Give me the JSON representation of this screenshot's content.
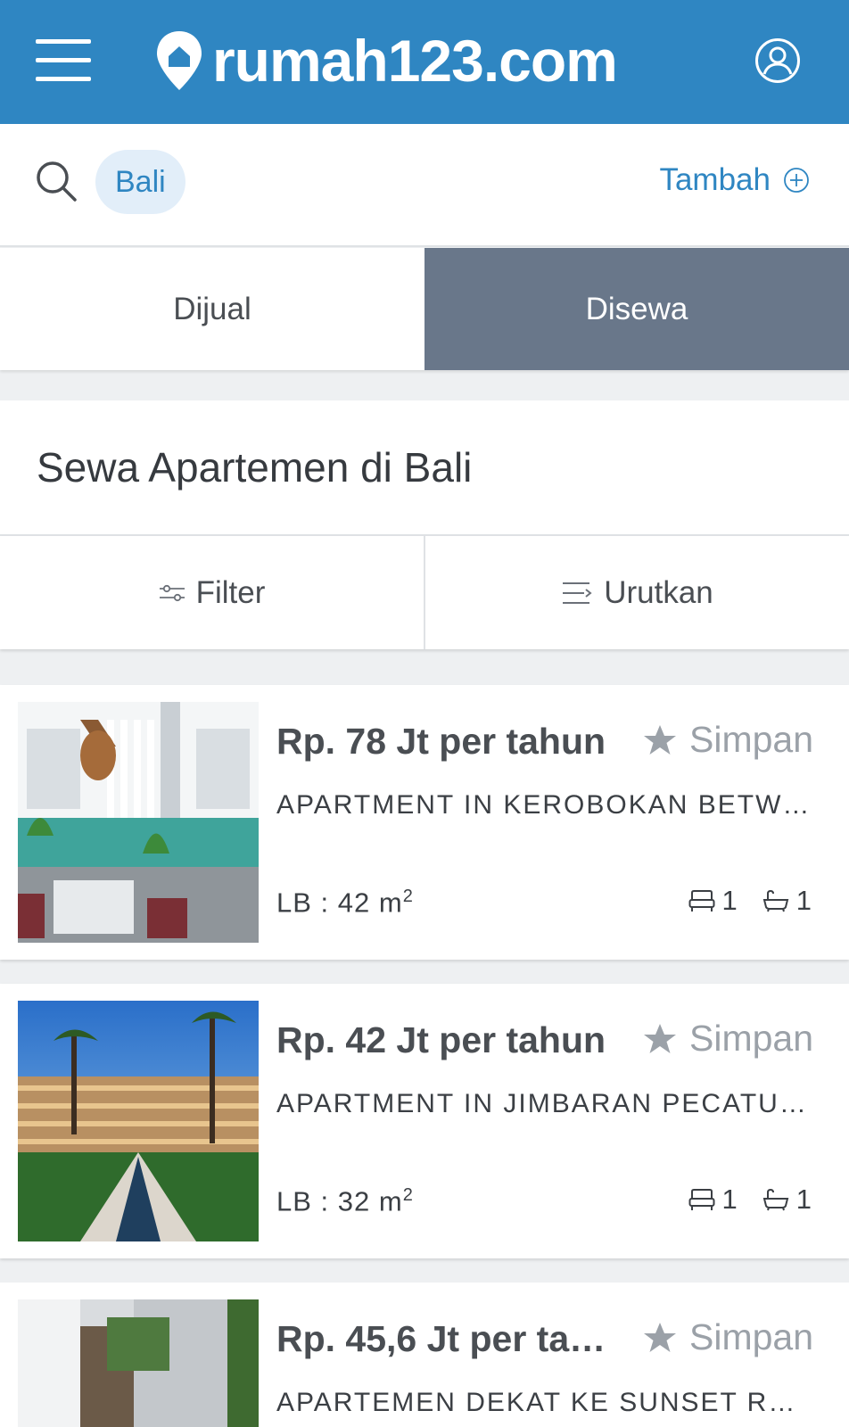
{
  "header": {
    "logo_text": "rumah123.com"
  },
  "search": {
    "chip": "Bali",
    "add_label": "Tambah"
  },
  "tabs": [
    {
      "label": "Dijual",
      "active": false
    },
    {
      "label": "Disewa",
      "active": true
    }
  ],
  "page_title": "Sewa Apartemen di Bali",
  "toolbar": {
    "filter_label": "Filter",
    "sort_label": "Urutkan"
  },
  "listings": [
    {
      "price": "Rp. 78 Jt per tahun",
      "save_label": "Simpan",
      "title": "APARTMENT IN KEROBOKAN BETWEE...",
      "area_label": "LB : 42 m",
      "area_unit_sup": "2",
      "bedrooms": "1",
      "bathrooms": "1"
    },
    {
      "price": "Rp. 42 Jt per tahun",
      "save_label": "Simpan",
      "title": "APARTMENT IN JIMBARAN PECATU C...",
      "area_label": "LB : 32 m",
      "area_unit_sup": "2",
      "bedrooms": "1",
      "bathrooms": "1"
    },
    {
      "price": "Rp. 45,6 Jt per tah...",
      "save_label": "Simpan",
      "title": "APARTEMEN DEKAT KE SUNSET ROAD...",
      "area_label": "",
      "area_unit_sup": "",
      "bedrooms": "",
      "bathrooms": ""
    }
  ],
  "colors": {
    "brand_blue": "#2f86c2",
    "active_tab": "#69778a",
    "chip_bg": "#e2eef9",
    "muted": "#9ba1a8"
  },
  "icons": [
    "menu-icon",
    "location-pin-logo-icon",
    "user-icon",
    "search-icon",
    "plus-circle-icon",
    "filter-sliders-icon",
    "sort-lines-icon",
    "star-icon",
    "bed-icon",
    "bathtub-icon"
  ]
}
